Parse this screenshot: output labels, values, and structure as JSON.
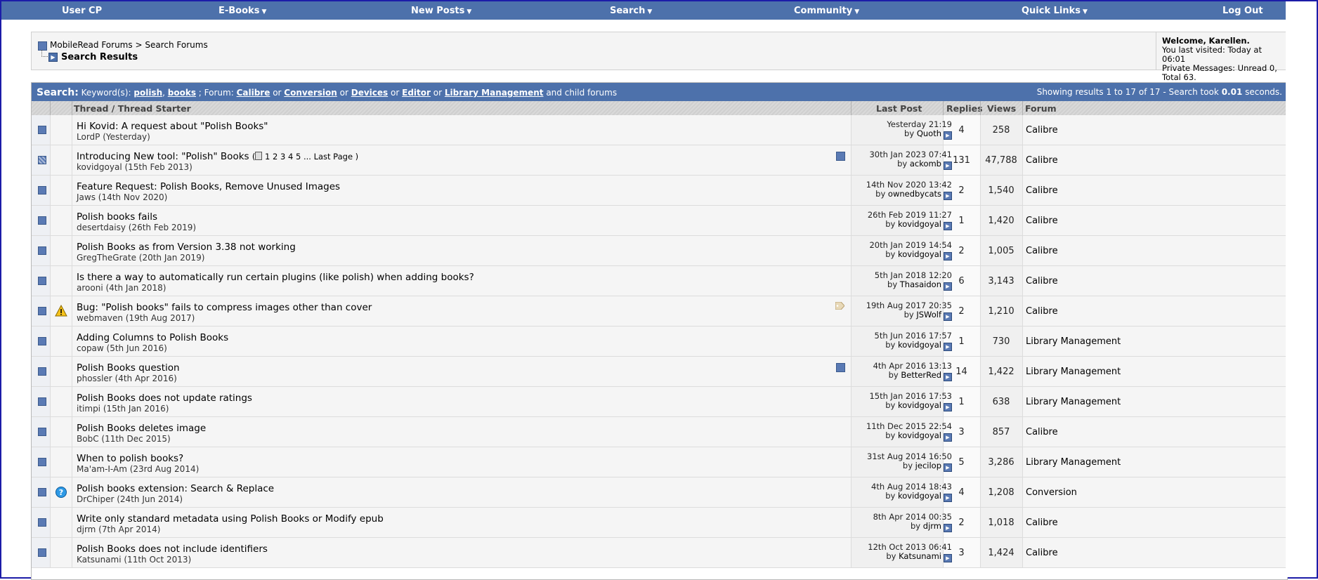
{
  "nav": {
    "items": [
      {
        "label": "User CP",
        "caret": false
      },
      {
        "label": "E-Books",
        "caret": true
      },
      {
        "label": "New Posts",
        "caret": true
      },
      {
        "label": "Search",
        "caret": true
      },
      {
        "label": "Community",
        "caret": true
      },
      {
        "label": "Quick Links",
        "caret": true
      },
      {
        "label": "Log Out",
        "caret": false
      }
    ]
  },
  "breadcrumb": {
    "root": "MobileRead Forums",
    "separator": ">",
    "parent": "Search Forums",
    "title": "Search Results"
  },
  "welcome": {
    "greeting": "Welcome,",
    "user": "Karellen.",
    "last_visit": "You last visited: Today at 06:01",
    "pm": "Private Messages: Unread 0, Total 63."
  },
  "search": {
    "label": "Search:",
    "keywords_label": "Keyword(s):",
    "kw1": "polish",
    "kw2": "books",
    "forum_label": "; Forum:",
    "f1": "Calibre",
    "f2": "Conversion",
    "f3": "Devices",
    "f4": "Editor",
    "f5": "Library Management",
    "or": "or",
    "tail": "and child forums",
    "summary_pre": "Showing results 1 to 17 of 17 - Search took",
    "summary_time": "0.01",
    "summary_post": "seconds."
  },
  "columns": {
    "thread": "Thread / Thread Starter",
    "last_post": "Last Post",
    "replies": "Replies",
    "views": "Views",
    "forum": "Forum"
  },
  "threads": [
    {
      "title": "Hi Kovid: A request about \"Polish Books\"",
      "starter": "LordP (Yesterday)",
      "date": "Yesterday 21:19",
      "by": "Quoth",
      "replies": "4",
      "views": "258",
      "forum": "Calibre",
      "icon": "none",
      "hot": false,
      "extra": "none"
    },
    {
      "title": "Introducing New tool: \"Polish\" Books",
      "starter": "kovidgoyal (15th Feb 2013)",
      "date": "30th Jan 2023 07:41",
      "by": "ackomb",
      "replies": "131",
      "views": "47,788",
      "forum": "Calibre",
      "icon": "none",
      "hot": true,
      "extra": "attach",
      "pages": [
        "1",
        "2",
        "3",
        "4",
        "5",
        "...",
        "Last Page"
      ]
    },
    {
      "title": "Feature Request: Polish Books, Remove Unused Images",
      "starter": "Jaws (14th Nov 2020)",
      "date": "14th Nov 2020 13:42",
      "by": "ownedbycats",
      "replies": "2",
      "views": "1,540",
      "forum": "Calibre",
      "icon": "none",
      "hot": false,
      "extra": "none"
    },
    {
      "title": "Polish books fails",
      "starter": "desertdaisy (26th Feb 2019)",
      "date": "26th Feb 2019 11:27",
      "by": "kovidgoyal",
      "replies": "1",
      "views": "1,420",
      "forum": "Calibre",
      "icon": "none",
      "hot": false,
      "extra": "none"
    },
    {
      "title": "Polish Books as from Version 3.38 not working",
      "starter": "GregTheGrate (20th Jan 2019)",
      "date": "20th Jan 2019 14:54",
      "by": "kovidgoyal",
      "replies": "2",
      "views": "1,005",
      "forum": "Calibre",
      "icon": "none",
      "hot": false,
      "extra": "none"
    },
    {
      "title": "Is there a way to automatically run certain plugins (like polish) when adding books?",
      "starter": "arooni (4th Jan 2018)",
      "date": "5th Jan 2018 12:20",
      "by": "Thasaidon",
      "replies": "6",
      "views": "3,143",
      "forum": "Calibre",
      "icon": "none",
      "hot": false,
      "extra": "none"
    },
    {
      "title": "Bug: \"Polish books\" fails to compress images other than cover",
      "starter": "webmaven (19th Aug 2017)",
      "date": "19th Aug 2017 20:35",
      "by": "JSWolf",
      "replies": "2",
      "views": "1,210",
      "forum": "Calibre",
      "icon": "warning",
      "hot": false,
      "extra": "tag"
    },
    {
      "title": "Adding Columns to Polish Books",
      "starter": "copaw (5th Jun 2016)",
      "date": "5th Jun 2016 17:57",
      "by": "kovidgoyal",
      "replies": "1",
      "views": "730",
      "forum": "Library Management",
      "icon": "none",
      "hot": false,
      "extra": "none"
    },
    {
      "title": "Polish Books question",
      "starter": "phossler (4th Apr 2016)",
      "date": "4th Apr 2016 13:13",
      "by": "BetterRed",
      "replies": "14",
      "views": "1,422",
      "forum": "Library Management",
      "icon": "none",
      "hot": false,
      "extra": "attach"
    },
    {
      "title": "Polish Books does not update ratings",
      "starter": "itimpi (15th Jan 2016)",
      "date": "15th Jan 2016 17:53",
      "by": "kovidgoyal",
      "replies": "1",
      "views": "638",
      "forum": "Library Management",
      "icon": "none",
      "hot": false,
      "extra": "none"
    },
    {
      "title": "Polish Books deletes image",
      "starter": "BobC (11th Dec 2015)",
      "date": "11th Dec 2015 22:54",
      "by": "kovidgoyal",
      "replies": "3",
      "views": "857",
      "forum": "Calibre",
      "icon": "none",
      "hot": false,
      "extra": "none"
    },
    {
      "title": "When to polish books?",
      "starter": "Ma'am-I-Am (23rd Aug 2014)",
      "date": "31st Aug 2014 16:50",
      "by": "jecilop",
      "replies": "5",
      "views": "3,286",
      "forum": "Library Management",
      "icon": "none",
      "hot": false,
      "extra": "none"
    },
    {
      "title": "Polish books extension: Search & Replace",
      "starter": "DrChiper (24th Jun 2014)",
      "date": "4th Aug 2014 18:43",
      "by": "kovidgoyal",
      "replies": "4",
      "views": "1,208",
      "forum": "Conversion",
      "icon": "question",
      "hot": false,
      "extra": "none"
    },
    {
      "title": "Write only standard metadata using Polish Books or Modify epub",
      "starter": "djrm (7th Apr 2014)",
      "date": "8th Apr 2014 00:35",
      "by": "djrm",
      "replies": "2",
      "views": "1,018",
      "forum": "Calibre",
      "icon": "none",
      "hot": false,
      "extra": "none"
    },
    {
      "title": "Polish Books does not include identifiers",
      "starter": "Katsunami (11th Oct 2013)",
      "date": "12th Oct 2013 06:41",
      "by": "Katsunami",
      "replies": "3",
      "views": "1,424",
      "forum": "Calibre",
      "icon": "none",
      "hot": false,
      "extra": "none"
    }
  ],
  "by_label": "by",
  "colors": {
    "accent": "#4d71ab",
    "border": "#1c1ca8"
  }
}
